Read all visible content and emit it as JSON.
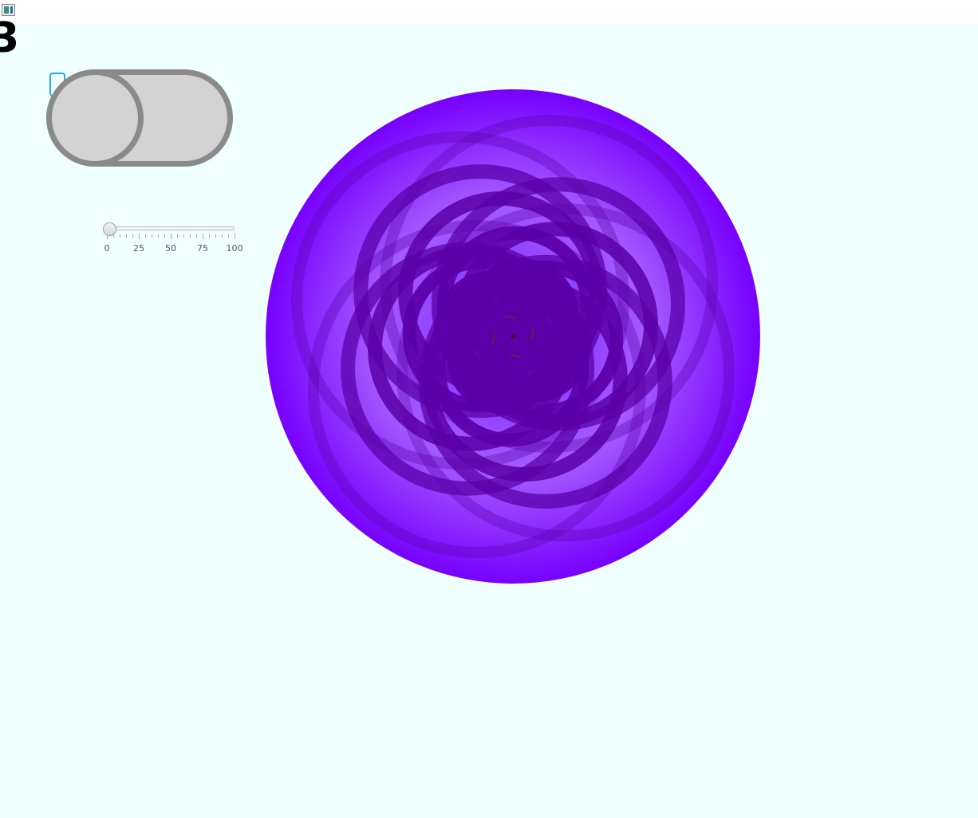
{
  "window": {
    "icon": "app-window-icon",
    "corner_glyph": "3"
  },
  "toggle": {
    "state": "off",
    "track_color": "#d3d3d3",
    "border_color": "#8a8a8a"
  },
  "slider": {
    "min": 0,
    "max": 100,
    "value": 0,
    "major_tick_unit": 25,
    "minor_tick_count": 4,
    "tick_labels": [
      "0",
      "25",
      "50",
      "75",
      "100"
    ]
  },
  "artwork": {
    "outer_color": "#7700ff",
    "inner_glow_color": "#a55cff",
    "center_color": "#500020",
    "stroke_color": "#5a00a8",
    "pattern_rotations": 4
  },
  "colors": {
    "background": "#f0ffff",
    "focus_ring": "#2aa8d8"
  }
}
